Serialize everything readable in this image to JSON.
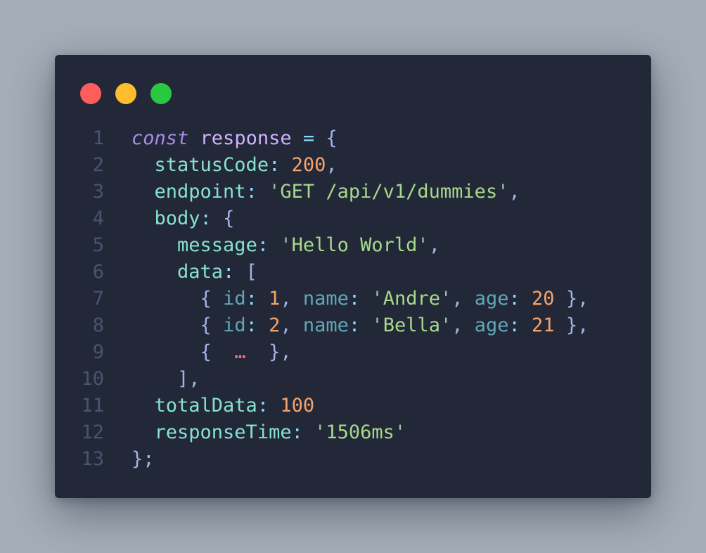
{
  "window": {
    "controls": [
      {
        "name": "close",
        "color": "#ff5c5c"
      },
      {
        "name": "minimize",
        "color": "#ffbd2e"
      },
      {
        "name": "maximize",
        "color": "#28c840"
      }
    ]
  },
  "code": {
    "lines": [
      {
        "n": "1",
        "tokens": [
          {
            "t": "const",
            "c": "kw"
          },
          {
            "t": " ",
            "c": "punc"
          },
          {
            "t": "response",
            "c": "var"
          },
          {
            "t": " = ",
            "c": "op"
          },
          {
            "t": "{",
            "c": "punc"
          }
        ]
      },
      {
        "n": "2",
        "tokens": [
          {
            "t": "  ",
            "c": "punc"
          },
          {
            "t": "statusCode",
            "c": "prop"
          },
          {
            "t": ": ",
            "c": "op"
          },
          {
            "t": "200",
            "c": "num"
          },
          {
            "t": ",",
            "c": "punc"
          }
        ]
      },
      {
        "n": "3",
        "tokens": [
          {
            "t": "  ",
            "c": "punc"
          },
          {
            "t": "endpoint",
            "c": "prop"
          },
          {
            "t": ": ",
            "c": "op"
          },
          {
            "t": "'",
            "c": "quote"
          },
          {
            "t": "GET /api/v1/dummies",
            "c": "str"
          },
          {
            "t": "'",
            "c": "quote"
          },
          {
            "t": ",",
            "c": "punc"
          }
        ]
      },
      {
        "n": "4",
        "tokens": [
          {
            "t": "  ",
            "c": "punc"
          },
          {
            "t": "body",
            "c": "prop"
          },
          {
            "t": ": ",
            "c": "op"
          },
          {
            "t": "{",
            "c": "punc"
          }
        ]
      },
      {
        "n": "5",
        "tokens": [
          {
            "t": "    ",
            "c": "punc"
          },
          {
            "t": "message",
            "c": "prop"
          },
          {
            "t": ": ",
            "c": "op"
          },
          {
            "t": "'",
            "c": "quote"
          },
          {
            "t": "Hello World",
            "c": "str"
          },
          {
            "t": "'",
            "c": "quote"
          },
          {
            "t": ",",
            "c": "punc"
          }
        ]
      },
      {
        "n": "6",
        "tokens": [
          {
            "t": "    ",
            "c": "punc"
          },
          {
            "t": "data",
            "c": "prop"
          },
          {
            "t": ": ",
            "c": "op"
          },
          {
            "t": "[",
            "c": "punc"
          }
        ]
      },
      {
        "n": "7",
        "tokens": [
          {
            "t": "      ",
            "c": "punc"
          },
          {
            "t": "{ ",
            "c": "punc"
          },
          {
            "t": "id",
            "c": "prop2"
          },
          {
            "t": ": ",
            "c": "op"
          },
          {
            "t": "1",
            "c": "num"
          },
          {
            "t": ", ",
            "c": "punc"
          },
          {
            "t": "name",
            "c": "prop2"
          },
          {
            "t": ": ",
            "c": "op"
          },
          {
            "t": "'",
            "c": "quote"
          },
          {
            "t": "Andre",
            "c": "str"
          },
          {
            "t": "'",
            "c": "quote"
          },
          {
            "t": ", ",
            "c": "punc"
          },
          {
            "t": "age",
            "c": "prop2"
          },
          {
            "t": ": ",
            "c": "op"
          },
          {
            "t": "20",
            "c": "num"
          },
          {
            "t": " },",
            "c": "punc"
          }
        ]
      },
      {
        "n": "8",
        "tokens": [
          {
            "t": "      ",
            "c": "punc"
          },
          {
            "t": "{ ",
            "c": "punc"
          },
          {
            "t": "id",
            "c": "prop2"
          },
          {
            "t": ": ",
            "c": "op"
          },
          {
            "t": "2",
            "c": "num"
          },
          {
            "t": ", ",
            "c": "punc"
          },
          {
            "t": "name",
            "c": "prop2"
          },
          {
            "t": ": ",
            "c": "op"
          },
          {
            "t": "'",
            "c": "quote"
          },
          {
            "t": "Bella",
            "c": "str"
          },
          {
            "t": "'",
            "c": "quote"
          },
          {
            "t": ", ",
            "c": "punc"
          },
          {
            "t": "age",
            "c": "prop2"
          },
          {
            "t": ": ",
            "c": "op"
          },
          {
            "t": "21",
            "c": "num"
          },
          {
            "t": " },",
            "c": "punc"
          }
        ]
      },
      {
        "n": "9",
        "tokens": [
          {
            "t": "      ",
            "c": "punc"
          },
          {
            "t": "{ ",
            "c": "punc"
          },
          {
            "t": " …",
            "c": "ell"
          },
          {
            "t": "  },",
            "c": "punc"
          }
        ]
      },
      {
        "n": "10",
        "tokens": [
          {
            "t": "   ",
            "c": "punc"
          },
          {
            "t": " ],",
            "c": "punc"
          }
        ]
      },
      {
        "n": "11",
        "tokens": [
          {
            "t": "  ",
            "c": "punc"
          },
          {
            "t": "totalData",
            "c": "prop"
          },
          {
            "t": ": ",
            "c": "op"
          },
          {
            "t": "100",
            "c": "num"
          }
        ]
      },
      {
        "n": "12",
        "tokens": [
          {
            "t": "  ",
            "c": "punc"
          },
          {
            "t": "responseTime",
            "c": "prop"
          },
          {
            "t": ": ",
            "c": "op"
          },
          {
            "t": "'",
            "c": "quote"
          },
          {
            "t": "1506ms",
            "c": "str"
          },
          {
            "t": "'",
            "c": "quote"
          }
        ]
      },
      {
        "n": "13",
        "tokens": [
          {
            "t": "};",
            "c": "punc"
          }
        ]
      }
    ]
  }
}
